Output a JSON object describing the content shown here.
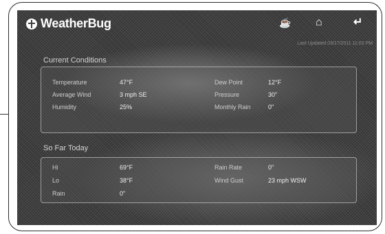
{
  "app": {
    "name": "WeatherBug"
  },
  "toolbar": {
    "cup_icon": "cup-icon",
    "home_icon": "home-icon",
    "back_icon": "back-arrow-icon"
  },
  "last_updated": "Last Updated 03/17/2011 11:03 PM",
  "current_conditions": {
    "title": "Current Conditions",
    "rows": [
      {
        "l1": "Temperature",
        "v1": "47°F",
        "l2": "Dew Point",
        "v2": "12°F"
      },
      {
        "l1": "Average Wind",
        "v1": "3 mph SE",
        "l2": "Pressure",
        "v2": "30\""
      },
      {
        "l1": "Humidity",
        "v1": "25%",
        "l2": "Monthly Rain",
        "v2": "0\""
      }
    ]
  },
  "so_far_today": {
    "title": "So Far Today",
    "rows": [
      {
        "l1": "Hi",
        "v1": "69°F",
        "l2": "Rain Rate",
        "v2": "0\""
      },
      {
        "l1": "Lo",
        "v1": "38°F",
        "l2": "Wind Gust",
        "v2": "23 mph WSW"
      },
      {
        "l1": "Rain",
        "v1": "0\"",
        "l2": "",
        "v2": ""
      }
    ]
  }
}
